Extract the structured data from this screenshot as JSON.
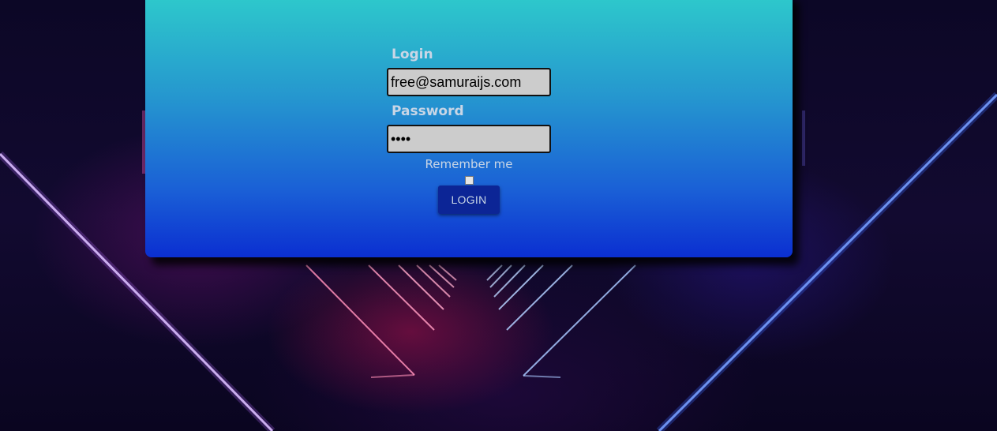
{
  "login_form": {
    "login_label": "Login",
    "login_value": "free@samuraijs.com",
    "password_label": "Password",
    "password_value": "free",
    "remember_label": "Remember me",
    "remember_checked": false,
    "submit_label": "LOGIN"
  },
  "colors": {
    "card_top": "#2ecbcb",
    "card_bottom": "#0b2fd1",
    "button": "#0c2596",
    "label_text": "#c9d6e6",
    "field_bg": "#cccccc"
  }
}
